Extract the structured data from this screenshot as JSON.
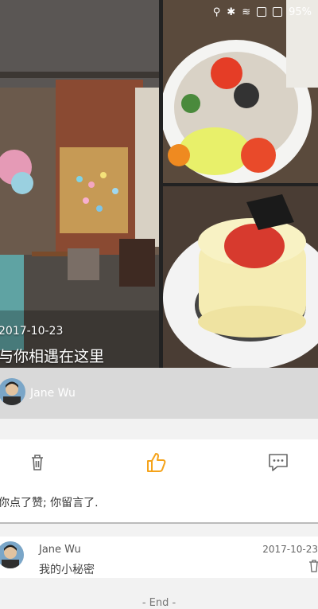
{
  "status": {
    "battery": "95%"
  },
  "post": {
    "date": "2017-10-23",
    "caption": "与你相遇在这里",
    "author": "Jane Wu"
  },
  "summary": "你点了赞; 你留言了.",
  "comment": {
    "author": "Jane Wu",
    "text": "我的小秘密",
    "date": "2017-10-23"
  },
  "footer": "- End -",
  "colors": {
    "like": "#f5a31a",
    "divider": "#bdbdbd"
  }
}
